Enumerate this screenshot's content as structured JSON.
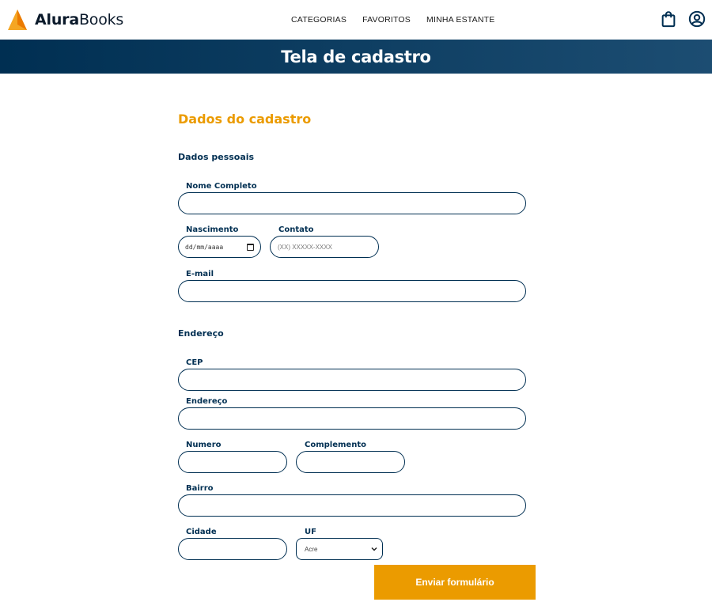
{
  "brand": {
    "name_bold": "Alura",
    "name_light": "Books",
    "colors": {
      "primary": "#002f52",
      "accent": "#eb9b00",
      "logo_orange": "#f5a623"
    }
  },
  "nav": {
    "items": [
      {
        "label": "CATEGORIAS"
      },
      {
        "label": "FAVORITOS"
      },
      {
        "label": "MINHA ESTANTE"
      }
    ],
    "icons": [
      "shopping-bag-icon",
      "user-profile-icon"
    ]
  },
  "banner": {
    "title": "Tela de cadastro"
  },
  "form": {
    "heading": "Dados do cadastro",
    "personal": {
      "title": "Dados pessoais",
      "full_name_label": "Nome Completo",
      "birth_label": "Nascimento",
      "birth_placeholder": "dd/mm/aaaa",
      "contact_label": "Contato",
      "contact_placeholder": "(XX) XXXXX-XXXX",
      "email_label": "E-mail"
    },
    "address": {
      "title": "Endereço",
      "cep_label": "CEP",
      "street_label": "Endereço",
      "number_label": "Numero",
      "complement_label": "Complemento",
      "district_label": "Bairro",
      "city_label": "Cidade",
      "uf_label": "UF",
      "uf_selected": "Acre"
    },
    "submit_label": "Enviar formulário"
  }
}
